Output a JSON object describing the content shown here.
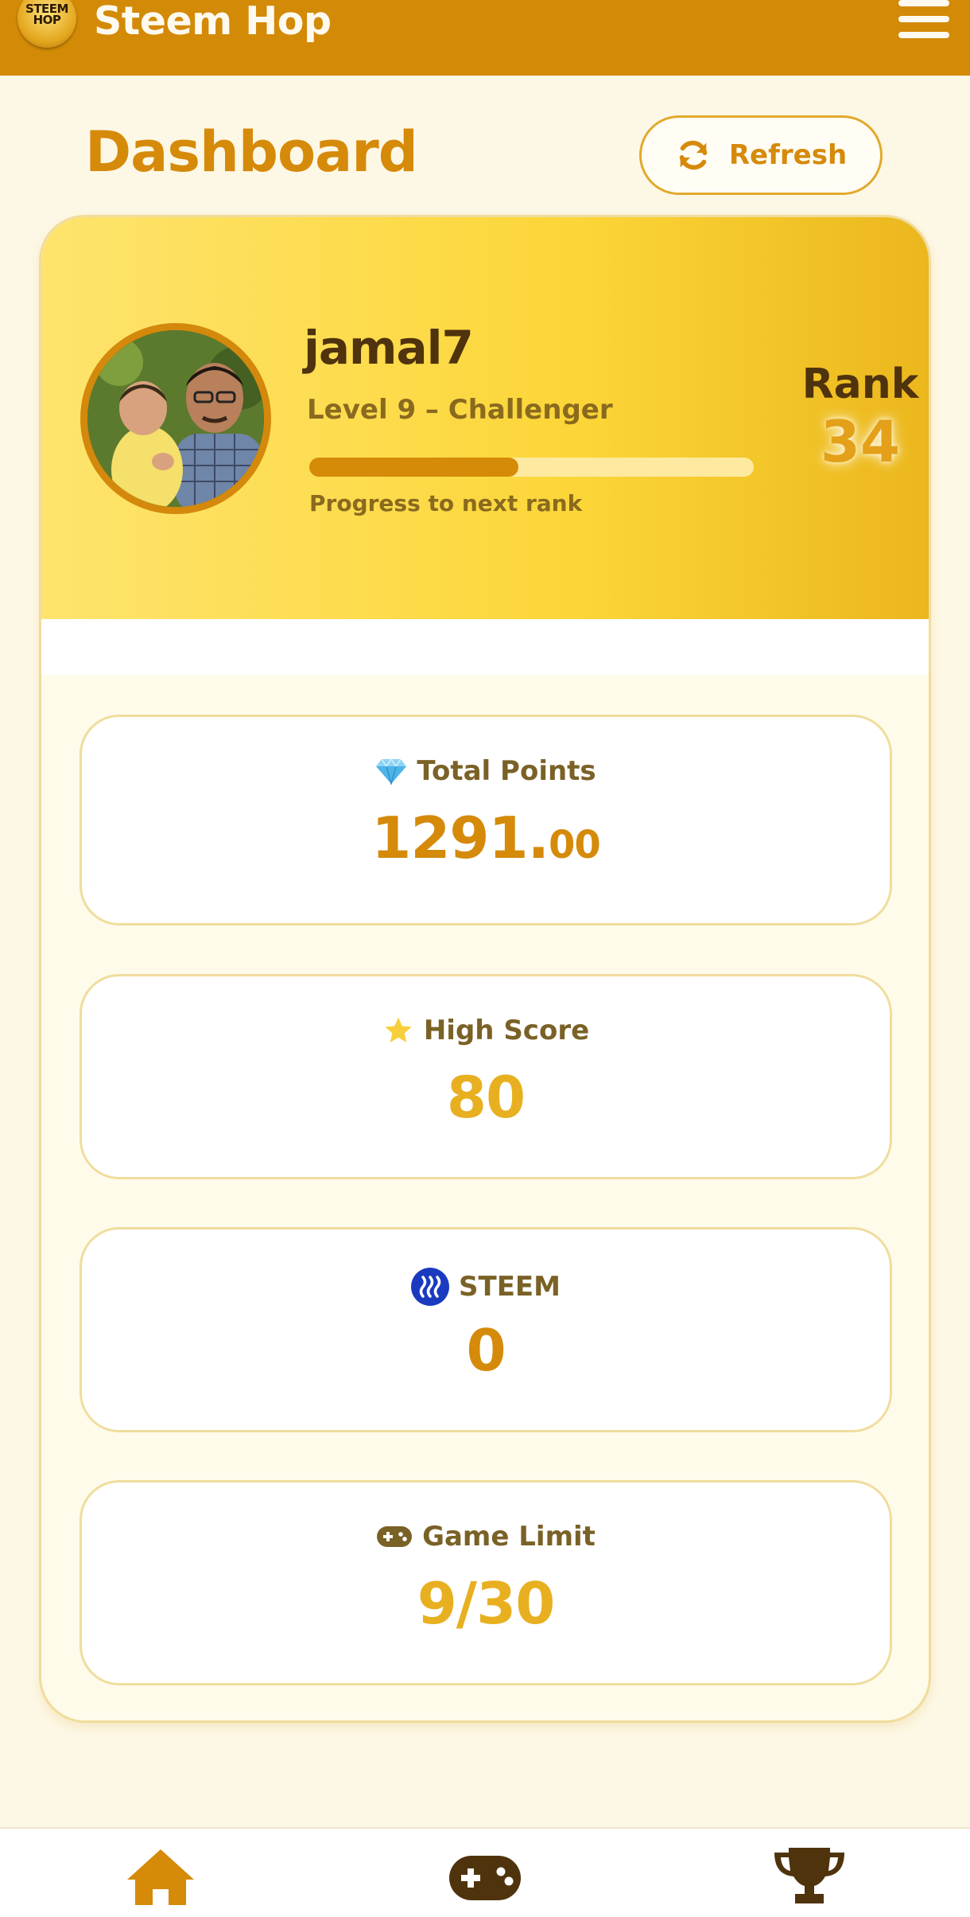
{
  "app": {
    "title": "Steem Hop",
    "logo_text_line1": "STEEM",
    "logo_text_line2": "HOP",
    "bar_color": "#d38a06"
  },
  "header": {
    "page_title": "Dashboard",
    "refresh_label": "Refresh"
  },
  "profile": {
    "username": "jamal7",
    "level_text": "Level 9 – Challenger",
    "progress_fraction": 0.47,
    "progress_label": "Progress to next rank",
    "rank_label": "Rank",
    "rank_value": "34"
  },
  "stats": [
    {
      "icon": "gem-icon",
      "label": "Total Points",
      "value_main": "1291.",
      "value_decimal": "00",
      "color": "#d58a0a"
    },
    {
      "icon": "star-icon",
      "label": "High Score",
      "value_main": "80",
      "color": "#e8b020"
    },
    {
      "icon": "steem-icon",
      "label": "STEEM",
      "value_main": "0",
      "color": "#d58a0a"
    },
    {
      "icon": "gamepad-icon",
      "label": "Game Limit",
      "value_main": "9/30",
      "color": "#e8b020"
    }
  ],
  "nav": {
    "items": [
      {
        "icon": "home-icon",
        "active": true
      },
      {
        "icon": "gamepad-icon",
        "active": false
      },
      {
        "icon": "trophy-icon",
        "active": false
      }
    ]
  }
}
